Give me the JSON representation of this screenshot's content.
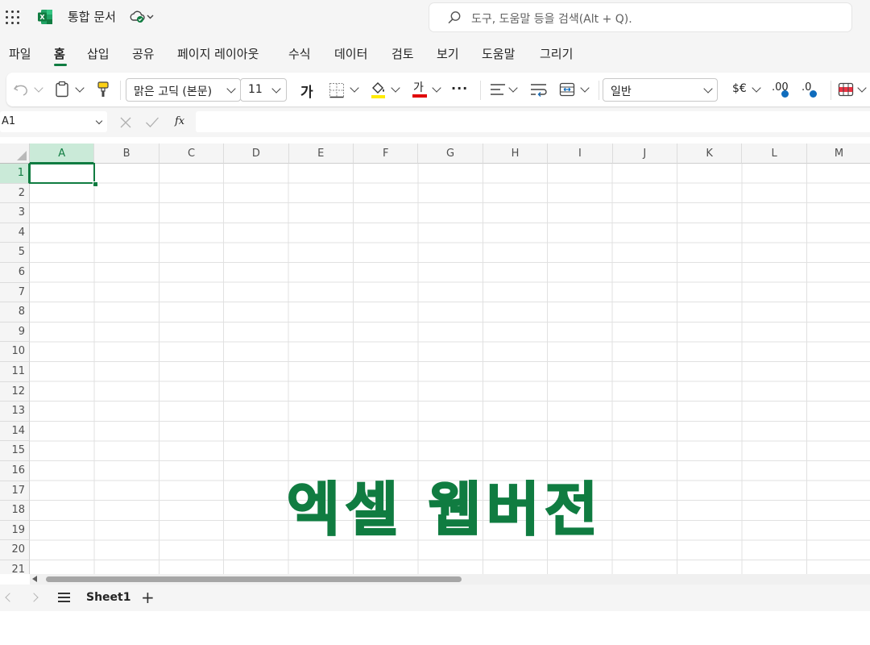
{
  "app": {
    "doc_title": "통합 문서",
    "search_placeholder": "도구, 도움말 등을 검색(Alt + Q)."
  },
  "menu": {
    "tabs": [
      "파일",
      "홈",
      "삽입",
      "공유",
      "페이지 레이아웃",
      "수식",
      "데이터",
      "검토",
      "보기",
      "도움말",
      "그리기"
    ],
    "active": "홈"
  },
  "ribbon": {
    "font_name": "맑은 고딕 (본문)",
    "font_size": "11",
    "bold_glyph": "가",
    "font_color_glyph": "가",
    "more": "···",
    "number_format": "일반",
    "currency": "$€",
    "increase_decimal": ".00",
    "decrease_decimal": ".0",
    "fill_color": "#ffeb00",
    "font_color": "#e00000"
  },
  "formula_bar": {
    "name_box": "A1",
    "fx": "fx",
    "value": ""
  },
  "grid": {
    "columns": [
      "A",
      "B",
      "C",
      "D",
      "E",
      "F",
      "G",
      "H",
      "I",
      "J",
      "K",
      "L",
      "M"
    ],
    "rows": [
      "1",
      "2",
      "3",
      "4",
      "5",
      "6",
      "7",
      "8",
      "9",
      "10",
      "11",
      "12",
      "13",
      "14",
      "15",
      "16",
      "17",
      "18",
      "19",
      "20",
      "21"
    ],
    "selected_cell": "A1"
  },
  "overlay_text": "엑셀 웹버전",
  "sheets": {
    "tabs": [
      "Sheet1"
    ],
    "add": "+"
  },
  "colors": {
    "accent": "#107c41",
    "selection_header": "#caead8"
  }
}
